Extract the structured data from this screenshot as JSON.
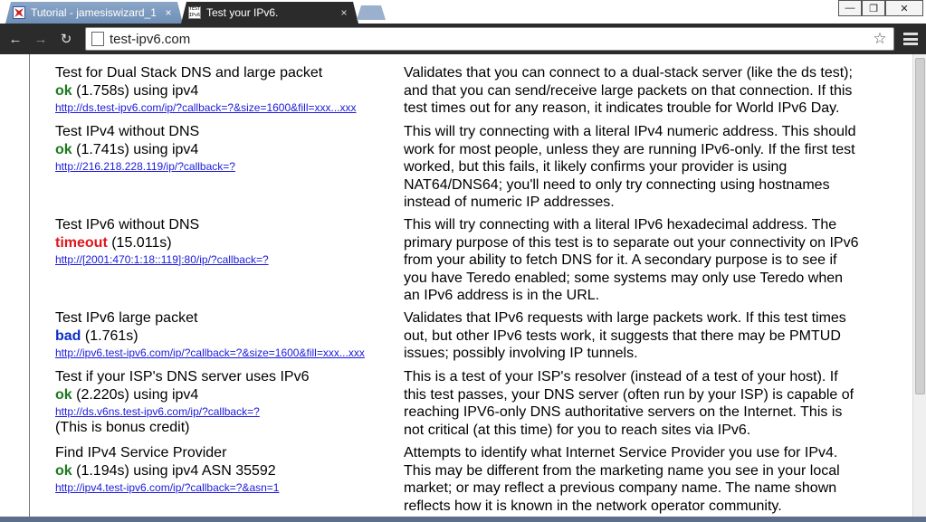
{
  "browser": {
    "tabs": [
      {
        "title": "Tutorial - jamesiswizard_1",
        "close": "×"
      },
      {
        "title": "Test your IPv6.",
        "favicon_text": "TEST IPv6",
        "close": "×"
      }
    ],
    "window_controls": {
      "minimize": "—",
      "maximize": "❐",
      "close": "✕"
    },
    "nav": {
      "back": "←",
      "forward": "→",
      "reload": "↻"
    },
    "url": "test-ipv6.com",
    "star": "☆"
  },
  "tests": [
    {
      "name": "Test for Dual Stack DNS and large packet",
      "status": "ok",
      "detail": " (1.758s) using ipv4",
      "link": "http://ds.test-ipv6.com/ip/?callback=?&size=1600&fill=xxx...xxx",
      "description": "Validates that you can connect to a dual-stack server (like the ds test); and that you can send/receive large packets on that connection. If this test times out for any reason, it indicates trouble for World IPv6 Day."
    },
    {
      "name": "Test IPv4 without DNS",
      "status": "ok",
      "detail": " (1.741s) using ipv4",
      "link": "http://216.218.228.119/ip/?callback=?",
      "description": "This will try connecting with a literal IPv4 numeric address. This should work for most people, unless they are running IPv6-only. If the first test worked, but this fails, it likely confirms your provider is using NAT64/DNS64; you'll need to only try connecting using hostnames instead of numeric IP addresses."
    },
    {
      "name": "Test IPv6 without DNS",
      "status": "timeout",
      "detail": " (15.011s)",
      "link": "http://[2001:470:1:18::119]:80/ip/?callback=?",
      "description": "This will try connecting with a literal IPv6 hexadecimal address. The primary purpose of this test is to separate out your connectivity on IPv6 from your ability to fetch DNS for it. A secondary purpose is to see if you have Teredo enabled; some systems may only use Teredo when an IPv6 address is in the URL."
    },
    {
      "name": "Test IPv6 large packet",
      "status": "bad",
      "detail": " (1.761s)",
      "link": "http://ipv6.test-ipv6.com/ip/?callback=?&size=1600&fill=xxx...xxx",
      "description": "Validates that IPv6 requests with large packets work. If this test times out, but other IPv6 tests work, it suggests that there may be PMTUD issues; possibly involving IP tunnels."
    },
    {
      "name": "Test if your ISP's DNS server uses IPv6",
      "status": "ok",
      "detail": " (2.220s) using ipv4",
      "link": "http://ds.v6ns.test-ipv6.com/ip/?callback=?",
      "extra": "(This is bonus credit)",
      "description": "This is a test of your ISP's resolver (instead of a test of your host). If this test passes, your DNS server (often run by your ISP) is capable of reaching IPV6-only DNS authoritative servers on the Internet. This is not critical (at this time) for you to reach sites via IPv6."
    },
    {
      "name": "Find IPv4 Service Provider",
      "status": "ok",
      "detail": " (1.194s) using ipv4 ASN 35592",
      "link": "http://ipv4.test-ipv6.com/ip/?callback=?&asn=1",
      "description": "Attempts to identify what Internet Service Provider you use for IPv4. This may be different from the marketing name you see in your local market; or may reflect a previous company name. The name shown reflects how it is known in the network operator community."
    }
  ],
  "colors": {
    "ok": "#1d7a1d",
    "timeout": "#e0161c",
    "bad": "#0b2ec8",
    "link": "#1a1adc"
  }
}
